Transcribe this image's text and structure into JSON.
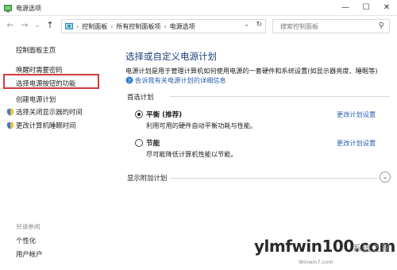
{
  "window": {
    "title": "电源选项",
    "controls": {
      "minimize": "—",
      "maximize": "☐",
      "close": "✕"
    }
  },
  "nav": {
    "back": "←",
    "forward": "→",
    "recent": "⌄",
    "up": "↑",
    "breadcrumbs": [
      "控制面板",
      "所有控制面板项",
      "电源选项"
    ],
    "separator": "›",
    "search_placeholder": "搜索控制面板"
  },
  "sidebar": {
    "items": [
      {
        "label": "控制面板主页"
      },
      {
        "label": "唤醒时需要密码"
      },
      {
        "label": "选择电源按钮的功能"
      },
      {
        "label": "创建电源计划"
      },
      {
        "label": "选择关闭显示器的时间"
      },
      {
        "label": "更改计算机睡眠时间"
      }
    ],
    "see_also": {
      "title": "另请参阅",
      "items": [
        {
          "label": "个性化"
        },
        {
          "label": "用户帐户"
        }
      ]
    }
  },
  "main": {
    "heading": "选择或自定义电源计划",
    "description": "电源计划是用于管理计算机如何使用电源的一套硬件和系统设置(如显示器亮度、睡眠等)",
    "more_link": "告诉我有关电源计划的详细信息",
    "preferred_title": "首选计划",
    "plans": [
      {
        "name": "平衡 (推荐)",
        "desc": "利用可用的硬件自动平衡功耗与性能。",
        "change": "更改计划设置",
        "selected": true
      },
      {
        "name": "节能",
        "desc": "尽可能降低计算机性能以节能。",
        "change": "更改计划设置",
        "selected": false
      }
    ],
    "extra_title": "显示附加计划"
  },
  "watermark": {
    "site": "ylmfwin100.com",
    "cn": "系统之家",
    "sub": "Winwin7.com"
  },
  "colors": {
    "link": "#2a5fb0",
    "heading": "#1f3f7a",
    "highlight_box": "#d23b3b"
  }
}
